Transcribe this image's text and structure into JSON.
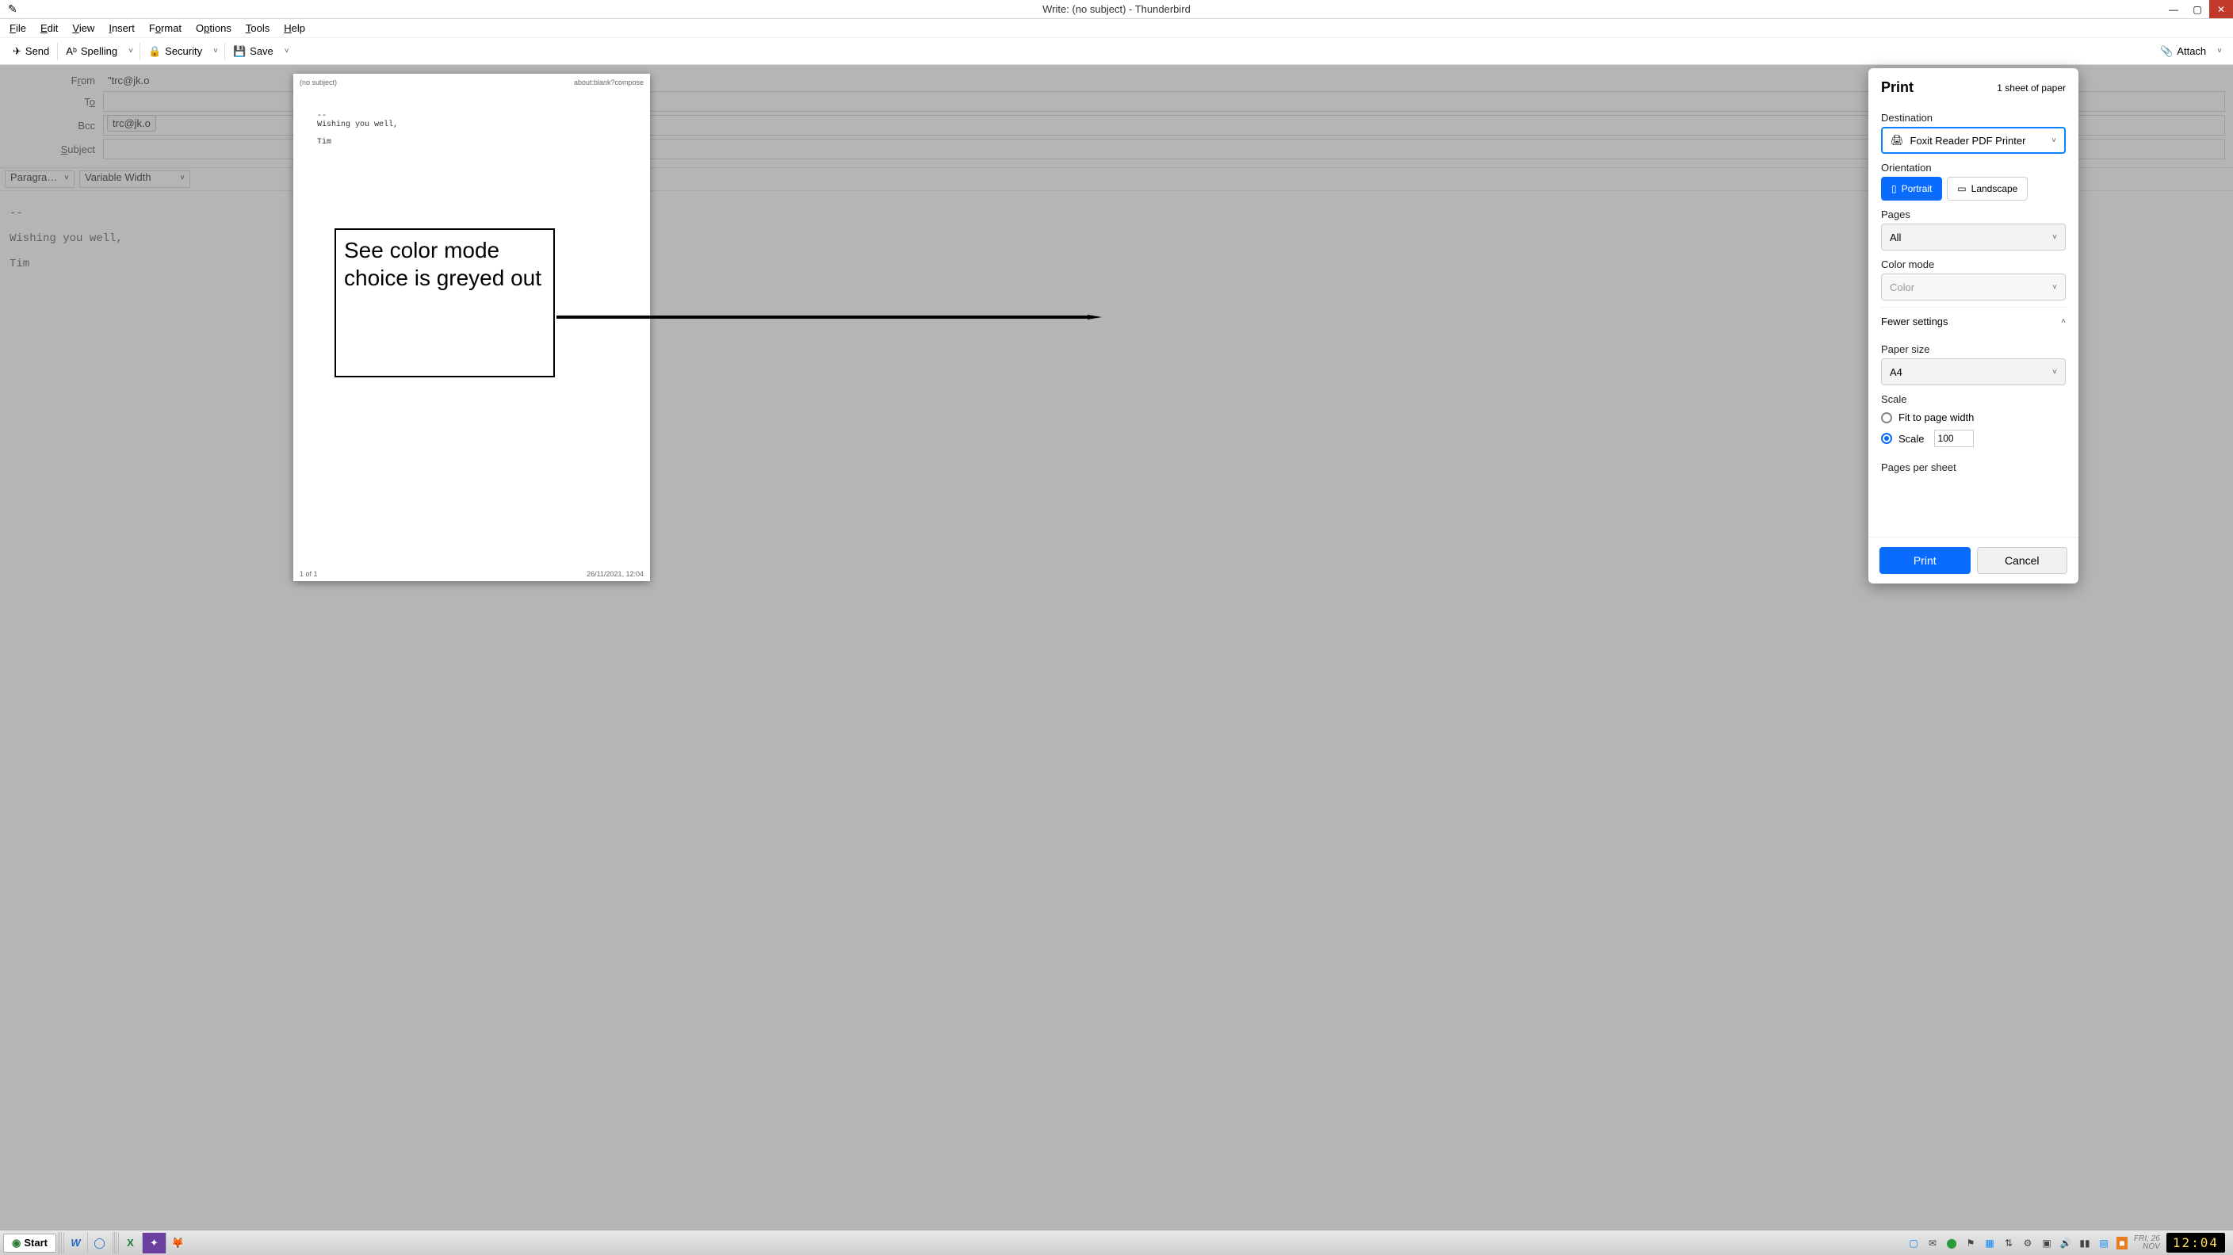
{
  "window": {
    "title": "Write: (no subject) - Thunderbird"
  },
  "menus": {
    "file": "File",
    "edit": "Edit",
    "view": "View",
    "insert": "Insert",
    "format": "Format",
    "options": "Options",
    "tools": "Tools",
    "help": "Help"
  },
  "toolbar": {
    "send": "Send",
    "spelling": "Spelling",
    "security": "Security",
    "save": "Save",
    "attach": "Attach"
  },
  "fields": {
    "from_label": "From",
    "from_value": "\"trc@jk.o",
    "to_label": "To",
    "to_value": "",
    "bcc_label": "Bcc",
    "bcc_value": "trc@jk.o",
    "subject_label": "Subject",
    "subject_value": ""
  },
  "format_bar": {
    "para": "Paragra…",
    "font": "Variable Width"
  },
  "editor_body": "--\n\nWishing you well,\n\nTim",
  "preview": {
    "head_left": "(no subject)",
    "head_right": "about:blank?compose",
    "body": "--\nWishing you well,\n\nTim",
    "foot_left": "1 of 1",
    "foot_right": "26/11/2021, 12:04"
  },
  "callout_text": "See color mode choice is greyed out",
  "print": {
    "title": "Print",
    "sheets": "1 sheet of paper",
    "destination_label": "Destination",
    "destination_value": "Foxit Reader PDF Printer",
    "orientation_label": "Orientation",
    "portrait": "Portrait",
    "landscape": "Landscape",
    "pages_label": "Pages",
    "pages_value": "All",
    "color_label": "Color mode",
    "color_value": "Color",
    "fewer": "Fewer settings",
    "paper_label": "Paper size",
    "paper_value": "A4",
    "scale_label": "Scale",
    "scale_fit": "Fit to page width",
    "scale_custom": "Scale",
    "scale_value": "100",
    "pps_label": "Pages per sheet",
    "print_btn": "Print",
    "cancel_btn": "Cancel"
  },
  "taskbar": {
    "start": "Start",
    "date_day": "FRI, 26",
    "date_month": "NOV",
    "clock": "12:04"
  }
}
